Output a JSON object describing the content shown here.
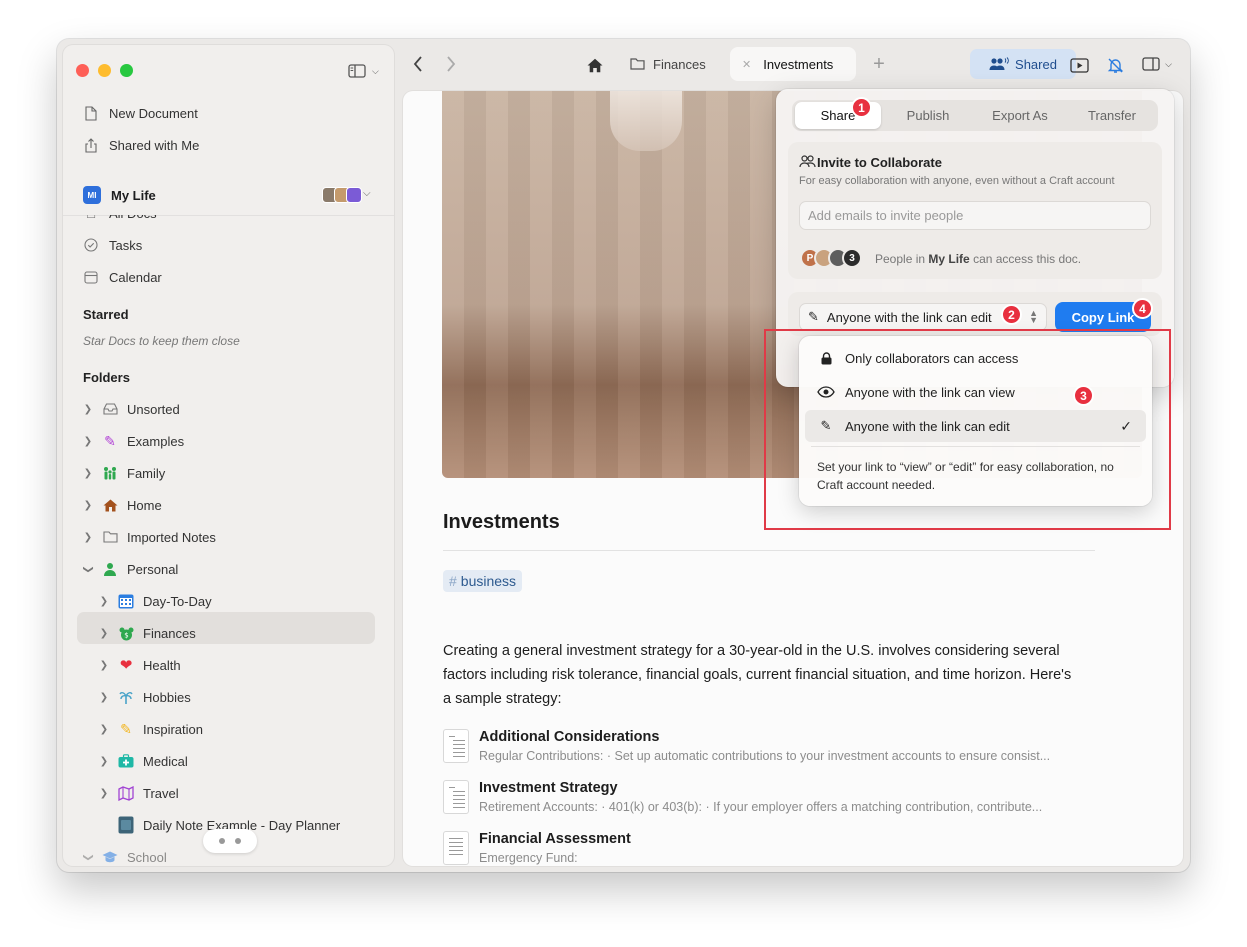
{
  "sidebar": {
    "top_items": [
      {
        "label": "New Document",
        "icon": "new-document-icon"
      },
      {
        "label": "Shared with Me",
        "icon": "share-icon"
      }
    ],
    "space": {
      "badge": "MI",
      "name": "My Life"
    },
    "partial_item": "All Docs",
    "space_items": [
      {
        "label": "Tasks",
        "icon": "check-circle-icon"
      },
      {
        "label": "Calendar",
        "icon": "calendar-icon"
      }
    ],
    "starred_title": "Starred",
    "starred_hint": "Star Docs to keep them close",
    "folders_title": "Folders",
    "folders": [
      {
        "label": "Unsorted",
        "icon": "inbox-icon"
      },
      {
        "label": "Examples",
        "icon": "pen-icon"
      },
      {
        "label": "Family",
        "icon": "family-icon"
      },
      {
        "label": "Home",
        "icon": "house-icon"
      },
      {
        "label": "Imported Notes",
        "icon": "folder-icon"
      },
      {
        "label": "Personal",
        "icon": "person-icon"
      }
    ],
    "personal_children": [
      {
        "label": "Day-To-Day",
        "icon": "calendar-grid-icon"
      },
      {
        "label": "Finances",
        "icon": "money-icon",
        "selected": true
      },
      {
        "label": "Health",
        "icon": "heart-icon"
      },
      {
        "label": "Hobbies",
        "icon": "palm-tree-icon"
      },
      {
        "label": "Inspiration",
        "icon": "pencil-icon"
      },
      {
        "label": "Medical",
        "icon": "medical-kit-icon"
      },
      {
        "label": "Travel",
        "icon": "map-icon"
      }
    ],
    "daily_note": "Daily Note Example - Day Planner",
    "school": "School"
  },
  "toolbar": {
    "tabs": [
      {
        "label": "Finances",
        "icon": "folder-icon"
      },
      {
        "label": "Investments",
        "active": true
      }
    ],
    "shared_label": "Shared"
  },
  "document": {
    "title": "Investments",
    "tag": "business",
    "body": "Creating a general investment strategy for a 30-year-old in the U.S. involves considering several factors including risk tolerance, financial goals, current financial situation, and time horizon. Here's a sample strategy:",
    "links": [
      {
        "title": "Additional Considerations",
        "subtitle": "Regular Contributions: · Set up automatic contributions to your investment accounts to ensure consist..."
      },
      {
        "title": "Investment Strategy",
        "subtitle": "Retirement Accounts: · 401(k) or 403(b): · If your employer offers a matching contribution, contribute..."
      },
      {
        "title": "Financial Assessment",
        "subtitle": "Emergency Fund:"
      }
    ]
  },
  "share_popover": {
    "tabs": [
      "Share",
      "Publish",
      "Export As",
      "Transfer"
    ],
    "active_tab": "Share",
    "invite_title": "Invite to Collaborate",
    "invite_subtitle": "For easy collaboration with anyone, even without a Craft account",
    "invite_placeholder": "Add emails to invite people",
    "people_avatars": [
      "P",
      "",
      "",
      "3"
    ],
    "people_prefix": "People in",
    "people_space": "My Life",
    "people_suffix": "can access this doc.",
    "link_permission": "Anyone with the link can edit",
    "copy_link": "Copy Link"
  },
  "permission_menu": {
    "options": [
      {
        "label": "Only collaborators can access",
        "icon": "lock-icon"
      },
      {
        "label": "Anyone with the link can view",
        "icon": "eye-icon"
      },
      {
        "label": "Anyone with the link can edit",
        "icon": "pencil-icon",
        "checked": true
      }
    ],
    "note": "Set your link to “view” or “edit” for easy collaboration, no Craft account needed."
  },
  "annotations": [
    "1",
    "2",
    "3",
    "4"
  ],
  "colors": {
    "accent": "#1f7cf0",
    "annotation": "#e8303f",
    "tag_bg": "#e4ebf4",
    "shared_bg": "#d4e2f4"
  }
}
